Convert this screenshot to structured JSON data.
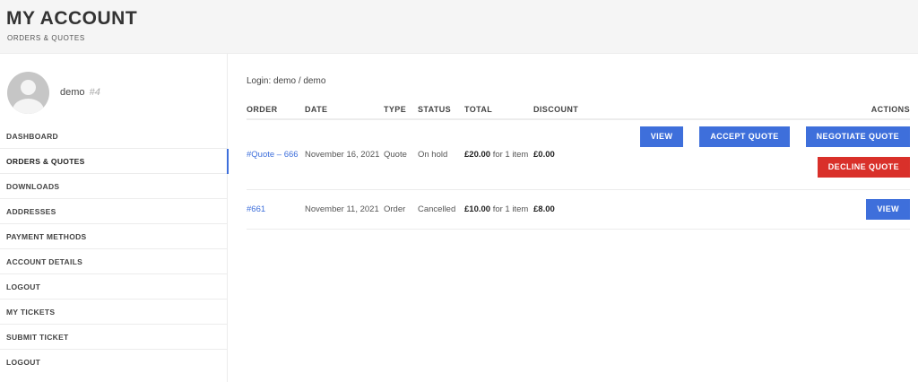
{
  "header": {
    "title": "MY ACCOUNT",
    "subtitle": "ORDERS & QUOTES"
  },
  "user": {
    "name": "demo",
    "id": "#4"
  },
  "menu": [
    {
      "label": "DASHBOARD"
    },
    {
      "label": "ORDERS & QUOTES",
      "active": true
    },
    {
      "label": "DOWNLOADS"
    },
    {
      "label": "ADDRESSES"
    },
    {
      "label": "PAYMENT METHODS"
    },
    {
      "label": "ACCOUNT DETAILS"
    },
    {
      "label": "LOGOUT"
    },
    {
      "label": "MY TICKETS"
    },
    {
      "label": "SUBMIT TICKET"
    },
    {
      "label": "LOGOUT"
    }
  ],
  "login_text": "Login: demo / demo",
  "table": {
    "columns": [
      "ORDER",
      "DATE",
      "TYPE",
      "STATUS",
      "TOTAL",
      "DISCOUNT",
      "ACTIONS"
    ],
    "rows": [
      {
        "order": "#Quote – 666",
        "date": "November 16, 2021",
        "type": "Quote",
        "status": "On hold",
        "total": "£20.00",
        "total_suffix": " for 1 item",
        "discount": "£0.00",
        "actions": [
          "VIEW",
          "ACCEPT QUOTE",
          "NEGOTIATE QUOTE",
          "DECLINE QUOTE"
        ]
      },
      {
        "order": "#661",
        "date": "November 11, 2021",
        "type": "Order",
        "status": "Cancelled",
        "total": "£10.00",
        "total_suffix": " for 1 item",
        "discount": "£8.00",
        "actions": [
          "VIEW"
        ]
      }
    ]
  },
  "colors": {
    "primary": "#3e6fdb",
    "danger": "#d9302a",
    "header_bg": "#f5f5f5"
  }
}
